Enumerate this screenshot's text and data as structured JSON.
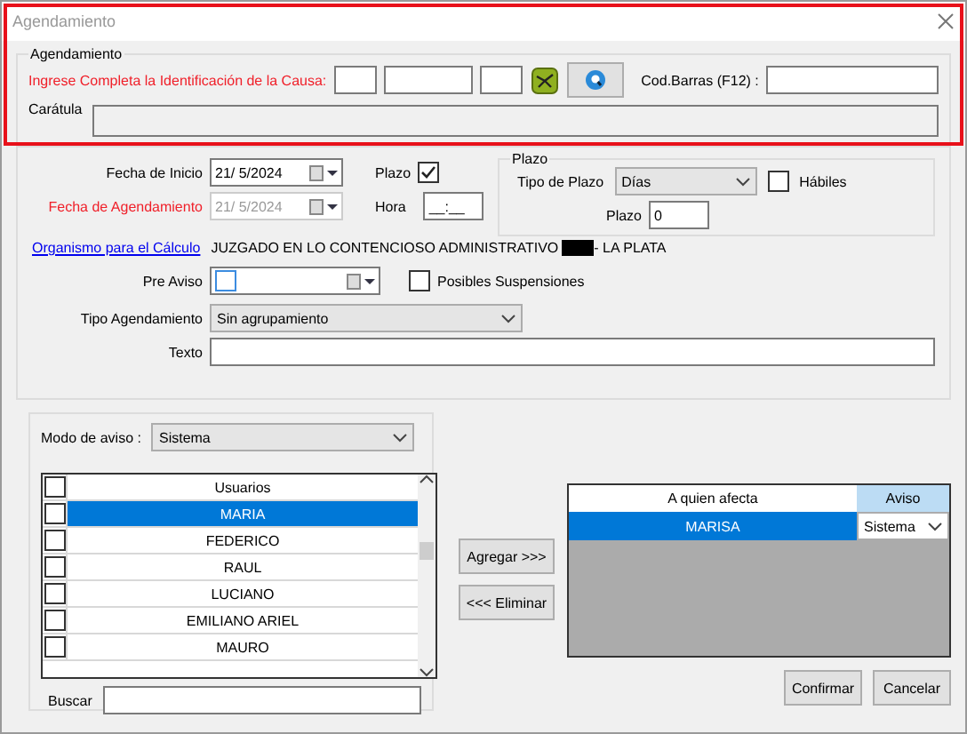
{
  "window": {
    "title": "Agendamiento"
  },
  "causa_group": {
    "legend": "Agendamiento",
    "id_label": "Ingrese Completa la Identificación de la Causa:",
    "barcode_label": "Cod.Barras (F12) :",
    "caratula_label": "Carátula"
  },
  "fechas": {
    "inicio_label": "Fecha de Inicio",
    "inicio_value": "21/ 5/2024",
    "agendamiento_label": "Fecha de Agendamiento",
    "agendamiento_value": "21/ 5/2024",
    "agendamiento_disabled": true,
    "plazo_label": "Plazo",
    "plazo_checked": true,
    "hora_label": "Hora",
    "hora_value": "__:__"
  },
  "plazo_group": {
    "legend": "Plazo",
    "tipo_label": "Tipo de Plazo",
    "tipo_value": "Días",
    "habiles_label": "Hábiles",
    "habiles_checked": false,
    "plazo_label": "Plazo",
    "plazo_value": "0"
  },
  "organismo": {
    "link": "Organismo para el Cálculo",
    "value_start": "JUZGADO EN LO CONTENCIOSO ADMINISTRATIVO",
    "value_end": "- LA PLATA"
  },
  "pre_aviso": {
    "label": "Pre Aviso",
    "checked": false,
    "suspensiones_label": "Posibles Suspensiones",
    "suspensiones_checked": false
  },
  "tipo_agendamiento": {
    "label": "Tipo Agendamiento",
    "value": "Sin agrupamiento"
  },
  "texto": {
    "label": "Texto"
  },
  "modo_aviso": {
    "label": "Modo de aviso :",
    "value": "Sistema"
  },
  "usuarios": {
    "header": "Usuarios",
    "header_checked": false,
    "rows": [
      {
        "name": "MARIA",
        "checked": false,
        "selected": true
      },
      {
        "name": "FEDERICO",
        "checked": false,
        "selected": false
      },
      {
        "name": "RAUL",
        "checked": false,
        "selected": false
      },
      {
        "name": "LUCIANO",
        "checked": false,
        "selected": false
      },
      {
        "name": "EMILIANO ARIEL",
        "checked": false,
        "selected": false
      },
      {
        "name": "MAURO",
        "checked": false,
        "selected": false
      }
    ]
  },
  "buscar": {
    "label": "Buscar"
  },
  "buttons": {
    "agregar": "Agregar >>>",
    "eliminar": "<<< Eliminar",
    "confirmar": "Confirmar",
    "cancelar": "Cancelar"
  },
  "afecta": {
    "columns": [
      "A quien afecta",
      "Aviso"
    ],
    "rows": [
      {
        "name": "MARISA",
        "aviso": "Sistema",
        "selected": true
      }
    ]
  }
}
